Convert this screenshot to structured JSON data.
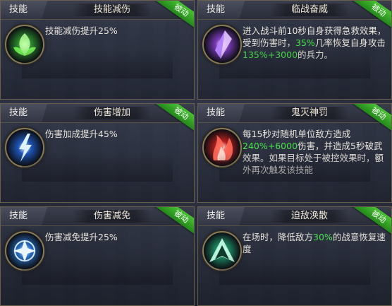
{
  "common": {
    "tag": "技能",
    "badge": "被动"
  },
  "cards": [
    {
      "name": "技能减伤",
      "desc": [
        {
          "t": "技能减伤提升25%"
        }
      ],
      "icon": "green-leaf-icon",
      "color": "#2e8a2c"
    },
    {
      "name": "临战奋威",
      "desc": [
        {
          "t": "进入战斗前10秒自身获得急救效果，受到伤害时，"
        },
        {
          "t": "35%",
          "hl": true
        },
        {
          "t": "几率恢复自身攻击"
        },
        {
          "t": "135%+3000",
          "hl": true
        },
        {
          "t": "的兵力。"
        }
      ],
      "icon": "purple-crystal-icon",
      "color": "#7a3bb8"
    },
    {
      "name": "伤害增加",
      "desc": [
        {
          "t": "伤害加成提升45%"
        }
      ],
      "icon": "blue-lightning-icon",
      "color": "#1e56b8"
    },
    {
      "name": "鬼灭神罚",
      "desc": [
        {
          "t": "每15秒对随机单位敌方造成"
        },
        {
          "t": "240%+6000",
          "hl": true
        },
        {
          "t": "伤害，并造成5秒破武效果。如果目标处于被控效果时，额外再次触发该技能"
        }
      ],
      "icon": "red-flame-icon",
      "color": "#b8201e"
    },
    {
      "name": "伤害减免",
      "desc": [
        {
          "t": "伤害减免提升25%"
        }
      ],
      "icon": "blue-shield-burst-icon",
      "color": "#2a6fc4"
    },
    {
      "name": "迫敌涣散",
      "desc": [
        {
          "t": "在场时，降低敌方"
        },
        {
          "t": "30%",
          "hl": true
        },
        {
          "t": "的战意恢复速度"
        }
      ],
      "icon": "green-arrow-emblem-icon",
      "color": "#1e8a64"
    }
  ]
}
